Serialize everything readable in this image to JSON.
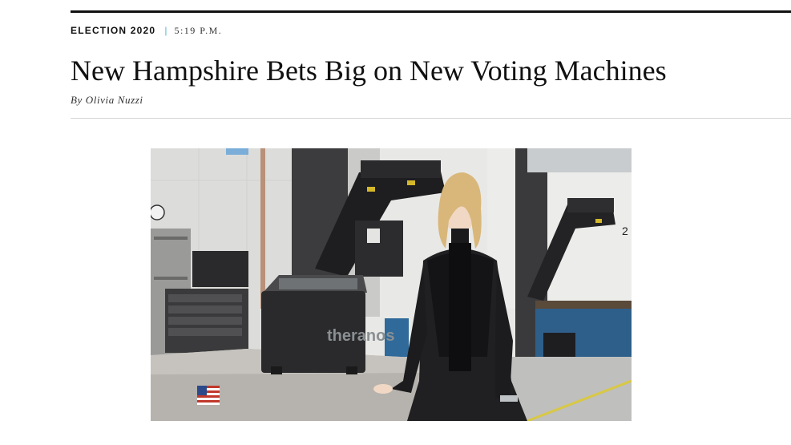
{
  "article": {
    "section": "ELECTION 2020",
    "separator": "|",
    "time": "5:19 P.M.",
    "headline": "New Hampshire Bets Big on New Voting Machines",
    "byline": "By Olivia Nuzzi"
  },
  "photo": {
    "machine_brand": "theranos",
    "number_sign": "2"
  },
  "colors": {
    "accent_separator": "#5ab3c8",
    "rule": "#d4d4d4",
    "text": "#111111"
  }
}
